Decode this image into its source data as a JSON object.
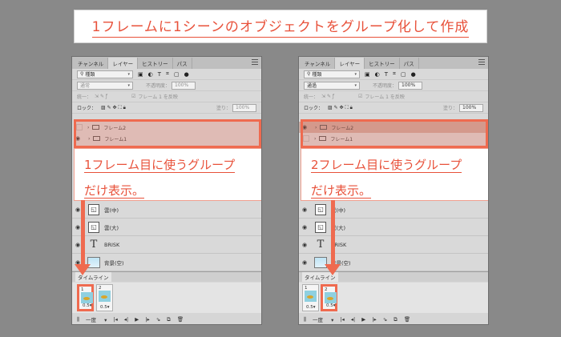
{
  "title": "1フレームに1シーンのオブジェクトをグループ化して作成",
  "tabs": [
    "チャンネル",
    "レイヤー",
    "ヒストリー",
    "パス"
  ],
  "search_label": "種類",
  "lock_label": "ロック：",
  "unify_label": "統一：",
  "propagate_label": "フレーム 1 を反映",
  "fill_label": "塗り：",
  "opacity_label": "不透明度：",
  "opacity_value": "100%",
  "layers": [
    {
      "label": "雲(中)",
      "thumb": "smart"
    },
    {
      "label": "雲(大)",
      "thumb": "smart"
    },
    {
      "label": "BRISK",
      "thumb": "text"
    },
    {
      "label": "背景(空)",
      "thumb": "bg"
    }
  ],
  "groups": [
    "フレーム2",
    "フレーム1"
  ],
  "timeline_label": "タイムライン",
  "frame_duration": "0.5",
  "loop_label": "一度",
  "left_panel": {
    "blend": "通常",
    "callout_line1": "1フレーム目に使うグループ",
    "callout_line2": "だけ表示。"
  },
  "right_panel": {
    "blend": "通過",
    "callout_line1": "2フレーム目に使うグループ",
    "callout_line2": "だけ表示。"
  },
  "colors": {
    "accent": "#ef6a4f",
    "text_accent": "#e8513a",
    "background": "#898989"
  }
}
